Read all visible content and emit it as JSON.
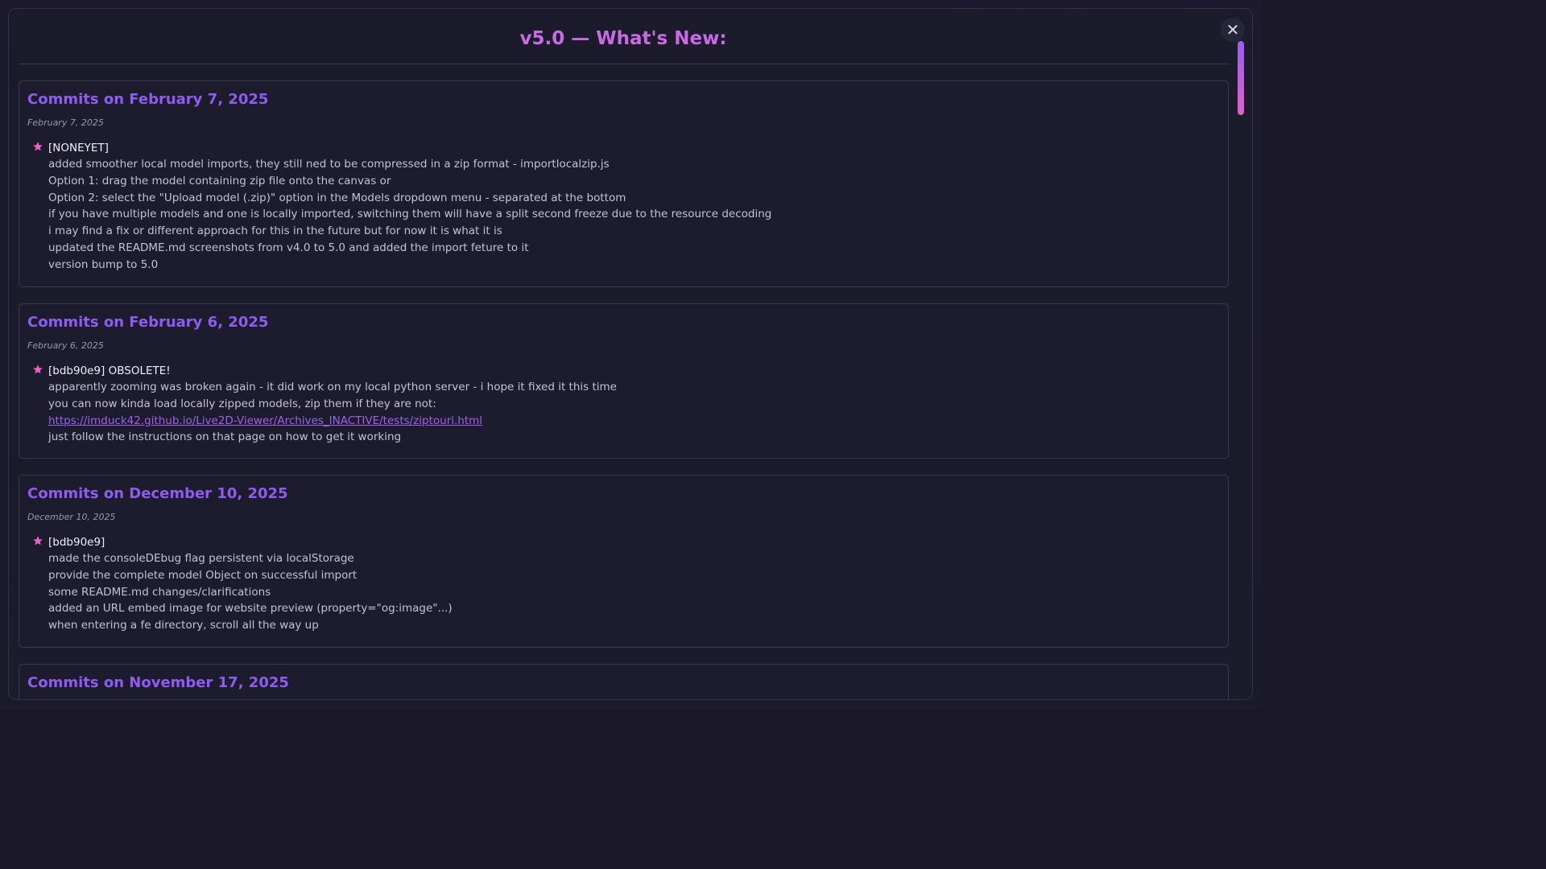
{
  "modal": {
    "title": "v5.0 — What's New:",
    "close_label": "✕"
  },
  "colors": {
    "title": "#c96ce4",
    "section_title": "#8f5cf0",
    "star": "#ec5fc4",
    "link": "#9a62ee",
    "scrollbar_gradient": [
      "#9b5cf6",
      "#e061c9"
    ]
  },
  "sections": [
    {
      "title": "Commits on February 7, 2025",
      "date": "February 7, 2025",
      "commit_id": "[NONEYET]",
      "lines": [
        "added smoother local model imports, they still ned to be compressed in a zip format - importlocalzip.js",
        "Option 1: drag the model containing zip file onto the canvas or",
        "Option 2: select the \"Upload model (.zip)\" option in the Models dropdown menu - separated at the bottom",
        "if you have multiple models and one is locally imported, switching them will have a split second freeze due to the resource decoding",
        "i may find a fix or different approach for this in the future but for now it is what it is",
        "updated the README.md screenshots from v4.0 to 5.0 and added the import feture to it",
        "version bump to 5.0"
      ]
    },
    {
      "title": "Commits on February 6, 2025",
      "date": "February 6, 2025",
      "commit_id": "[bdb90e9] OBSOLETE!",
      "lines": [
        "apparently zooming was broken again - it did work on my local python server - i hope it fixed it this time",
        "you can now kinda load locally zipped models, zip them if they are not:",
        "https://imduck42.github.io/Live2D-Viewer/Archives_INACTIVE/tests/ziptouri.html",
        "just follow the instructions on that page on how to get it working"
      ]
    },
    {
      "title": "Commits on December 10, 2025",
      "date": "December 10, 2025",
      "commit_id": "[bdb90e9]",
      "lines": [
        "made the consoleDEbug flag persistent via localStorage",
        "provide the complete model Object on successful import",
        "some README.md changes/clarifications",
        "added an URL embed image for website preview (property=\"og:image\"...)",
        "when entering a fe directory, scroll all the way up"
      ]
    },
    {
      "title": "Commits on November 17, 2025"
    }
  ]
}
